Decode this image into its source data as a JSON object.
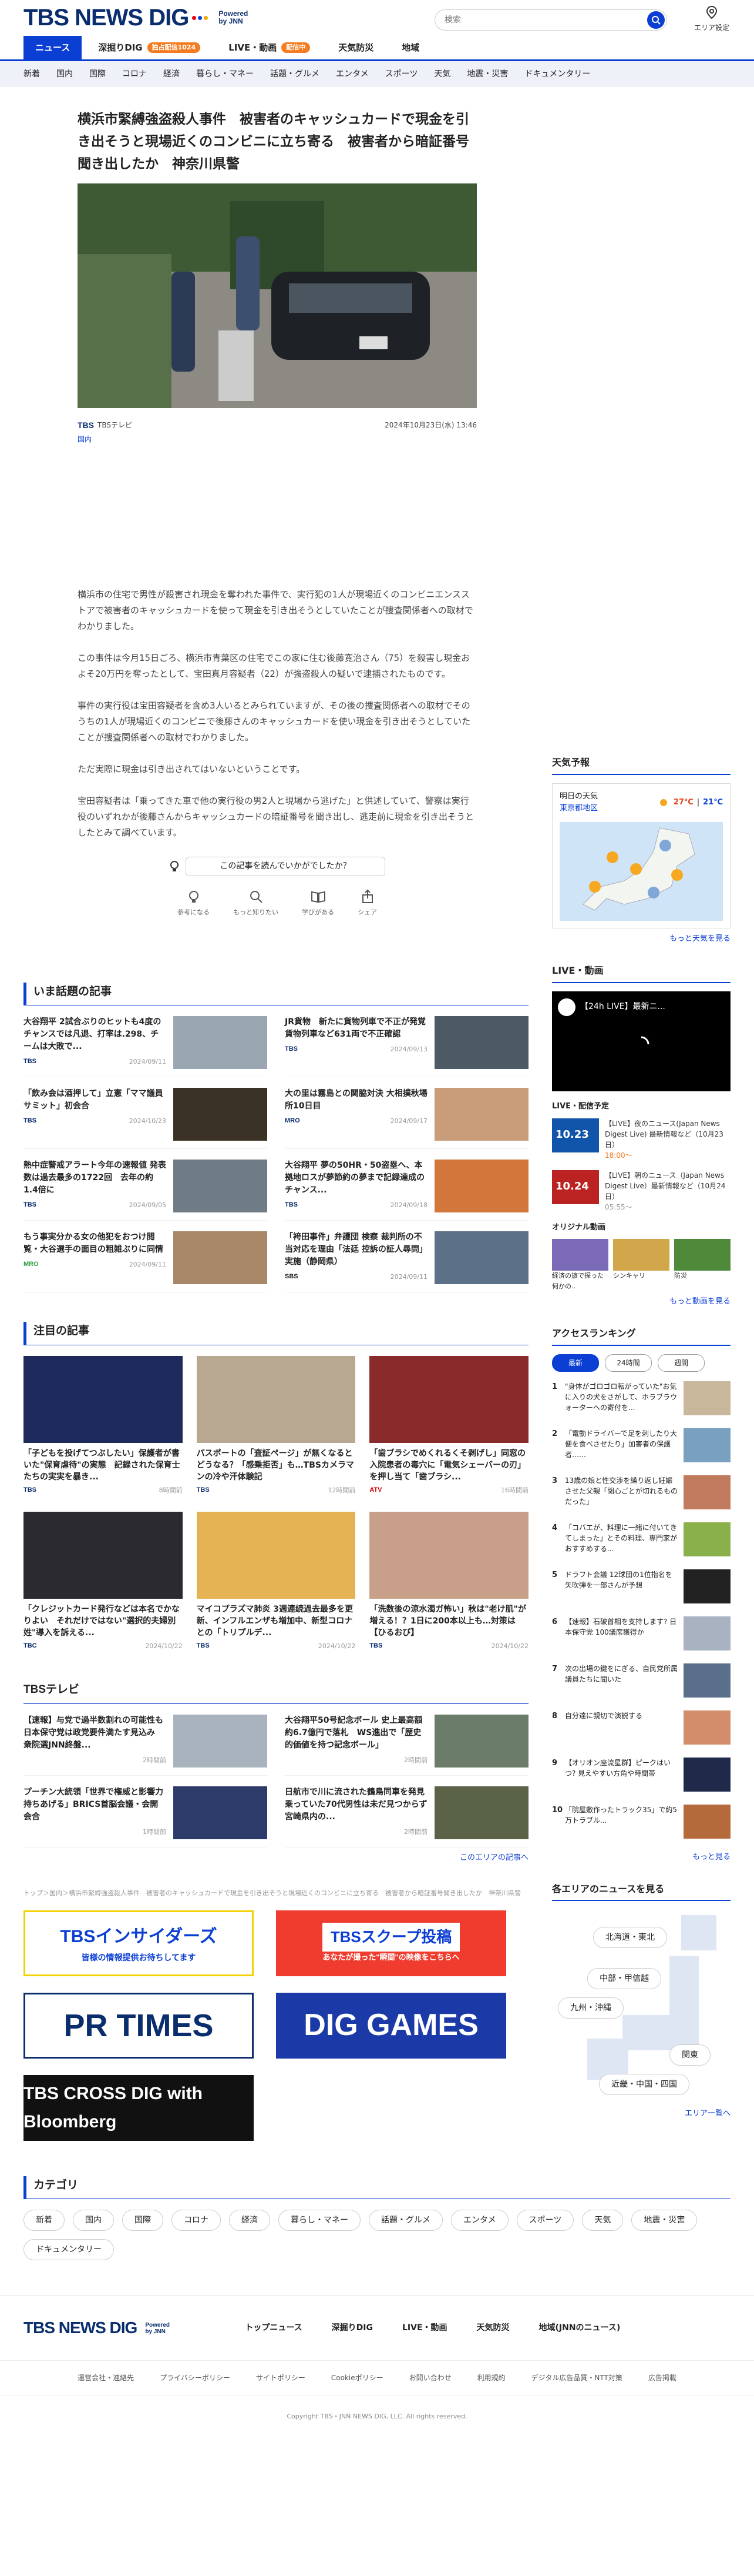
{
  "header": {
    "logo_text": "TBS NEWS DIG",
    "powered": "Powered by JNN",
    "search_placeholder": "検索",
    "area_label": "エリア設定"
  },
  "nav": {
    "tabs": [
      {
        "label": "ニュース",
        "active": true
      },
      {
        "label": "深掘りDIG",
        "badge": "独占配信1024"
      },
      {
        "label": "LIVE・動画",
        "badge": "配信中"
      },
      {
        "label": "天気防災"
      },
      {
        "label": "地域"
      }
    ],
    "categories": [
      "新着",
      "国内",
      "国際",
      "コロナ",
      "経済",
      "暮らし・マネー",
      "話題・グルメ",
      "エンタメ",
      "スポーツ",
      "天気",
      "地震・災害",
      "ドキュメンタリー"
    ]
  },
  "article": {
    "title": "横浜市緊縛強盗殺人事件　被害者のキャッシュカードで現金を引き出そうと現場近くのコンビニに立ち寄る　被害者から暗証番号聞き出したか　神奈川県警",
    "source": "TBSテレビ",
    "datetime": "2024年10月23日(水) 13:46",
    "category": "国内",
    "paragraphs": [
      "横浜市の住宅で男性が殺害され現金を奪われた事件で、実行犯の1人が現場近くのコンビニエンスストアで被害者のキャッシュカードを使って現金を引き出そうとしていたことが捜査関係者への取材でわかりました。",
      "この事件は今月15日ごろ、横浜市青葉区の住宅でこの家に住む後藤寛治さん（75）を殺害し現金およそ20万円を奪ったとして、宝田真月容疑者（22）が強盗殺人の疑いで逮捕されたものです。",
      "事件の実行役は宝田容疑者を含め3人いるとみられていますが、その後の捜査関係者への取材でそのうちの1人が現場近くのコンビニで後藤さんのキャッシュカードを使い現金を引き出そうとしていたことが捜査関係者への取材でわかりました。",
      "ただ実際に現金は引き出されてはいないということです。",
      "宝田容疑者は「乗ってきた車で他の実行役の男2人と現場から逃げた」と供述していて、警察は実行役のいずれかが後藤さんからキャッシュカードの暗証番号を聞き出し、逃走前に現金を引き出そうとしたとみて調べています。"
    ],
    "feedback_prompt": "この記事を読んでいかがでしたか？",
    "feedback_buttons": [
      "参考になる",
      "もっと知りたい",
      "学びがある",
      "シェア"
    ]
  },
  "sidebar": {
    "weather": {
      "title": "天気予報",
      "day": "明日の天気",
      "region": "東京都地区",
      "temp_high": "27℃",
      "temp_low": "21℃",
      "more": "もっと天気を見る"
    },
    "live": {
      "title": "LIVE・動画",
      "player_title": "【24h LIVE】最新ニ...",
      "schedule_title": "LIVE・配信予定",
      "items": [
        {
          "date": "10.23",
          "label": "【LIVE】夜のニュース(Japan News Digest Live) 最新情報など（10月23日）",
          "time": "18:00～"
        },
        {
          "date": "10.24",
          "label": "【LIVE】朝のニュース（Japan News Digest Live）最新情報など（10月24日）",
          "time": "05:55～"
        }
      ],
      "original_title": "オリジナル動画",
      "original_items": [
        "経済の旅で探った何かの..",
        "シンキャリ",
        "防災"
      ],
      "more": "もっと動画を見る"
    },
    "ranking": {
      "title": "アクセスランキング",
      "tabs": [
        "最新",
        "24時間",
        "週間"
      ],
      "items": [
        "\"身体がゴロゴロ転がっていた\"お気に入りの犬をさがして、ホラブラウォーターへの寄付を...",
        "「電動ドライバーで足を刺したり大便を食べさせたり」加害者の保護者……",
        "13歳の娘と性交渉を繰り返し妊娠させた父親「関心ごとが切れるものだった」",
        "「コバエが、料理に一緒に付いてきてしまった」とその料理、専門家がおすすめする...",
        "ドラフト会議 12球団の1位指名を矢吹弾を一部さんが予想",
        "【速報】石破首相を支持します? 日本保守党 100議席獲得か",
        "次の出場の鍵をにぎる、自民党所属議員たちに聞いた",
        "自分達に親切で演説する",
        "【オリオン座流星群】ピークはいつ? 見えやすい方角や時間帯",
        "「院屋敷作ったトラック35」で約5万トラブル..."
      ],
      "more": "もっと見る"
    },
    "area": {
      "title": "各エリアのニュースを見る",
      "buttons": [
        "北海道・東北",
        "中部・甲信越",
        "九州・沖縄",
        "関東",
        "近畿・中国・四国"
      ],
      "more": "エリア一覧へ"
    }
  },
  "trending": {
    "title": "いま話題の記事",
    "items": [
      {
        "text": "大谷翔平 2試合ぶりのヒットも4度のチャンスでは凡退、打率は.298、チームは大敗で...",
        "src": "TBS",
        "date": "2024/09/11"
      },
      {
        "text": "JR貨物　新たに貨物列車で不正が発覚　貨物列車など631両で不正確認",
        "src": "TBS",
        "date": "2024/09/13"
      },
      {
        "text": "「飲み会は酒押して」立憲「ママ議員サミット」初会合",
        "src": "TBS",
        "date": "2024/10/23"
      },
      {
        "text": "大の里は霧島との関脇対決 大相撲秋場所10日目",
        "src": "MRO",
        "date": "2024/09/17"
      },
      {
        "text": "熱中症警戒アラート今年の速報値 発表数は過去最多の1722回　去年の約1.4倍に",
        "src": "TBS",
        "date": "2024/09/05"
      },
      {
        "text": "大谷翔平 夢の50HR・50盗塁へ、本拠地ロスが夢節約の夢まで記録達成のチャンス...",
        "src": "TBS",
        "date": "2024/09/18"
      },
      {
        "text": "もう事実分かる女の他犯をおつけ閲覧・大谷選手の面目の粗雑ぶりに同情",
        "src": "MRO",
        "date": "2024/09/11"
      },
      {
        "text": "「袴田事件」弁護団 検察 裁判所の不当対応を理由「法廷 控訴の証人尋問」実施（静岡県）",
        "src": "SBS",
        "date": "2024/09/11"
      }
    ]
  },
  "featured": {
    "title": "注目の記事",
    "items": [
      {
        "text": "「子どもを投げてつぶしたい」保護者が書いた\"保育虐待\"の実態　記録された保育士たちの実実を暴き...",
        "src": "TBS",
        "date": "8時間前"
      },
      {
        "text": "パスポートの「査証ページ」が無くなるとどうなる？「感乗拒否」も…TBSカメラマンの冷や汗体験記",
        "src": "TBS",
        "date": "12時間前"
      },
      {
        "text": "「歯ブラシでめくれるくそ剥げし」同窓の入院患者の毒穴に「電気シェーバーの刃」を押し当て「歯ブラシ...",
        "src": "ATV",
        "date": "16時間前"
      },
      {
        "text": "「クレジットカード発行などは本名でかなりよい　それだけではない\"選択的夫婦別姓\"導入を訴える...",
        "src": "TBC",
        "date": "2024/10/22"
      },
      {
        "text": "マイコプラズマ肺炎 3週連続過去最多を更新、インフルエンザも増加中、新型コロナとの「トリプルデ...",
        "src": "TBS",
        "date": "2024/10/22"
      },
      {
        "text": "「洗数後の涼水濁ガ怖い」秋は\"老け肌\"が増える！？1日に200本以上も…対策は【ひるおび】",
        "src": "TBS",
        "date": "2024/10/22"
      }
    ]
  },
  "tbs_section": {
    "title": "TBSテレビ",
    "items": [
      {
        "text": "【速報】与党で過半数割れの可能性も　日本保守党は政党要件満たす見込み　衆院選JNN終盤...",
        "date": "2時間前"
      },
      {
        "text": "大谷翔平50号記念ボール 史上最高額 約6.7億円で落札　WS進出で「歴史的価値を持つ記念ボール」",
        "date": "2時間前"
      },
      {
        "text": "プーチン大統領「世界で権威と影響力持ちあげる」BRICS首脳会議・会開会合",
        "date": "1時間前"
      },
      {
        "text": "日航市で川に流された鶴鳥同車を発見　乗っていた70代男性は未だ見つからず　宮崎県内の...",
        "date": "2時間前"
      }
    ],
    "more": "このエリアの記事へ"
  },
  "breadcrumb": "トップ＞国内＞横浜市緊縛強盗殺人事件　被害者のキャッシュカードで現金を引き出そうと現場近くのコンビニに立ち寄る　被害者から暗証番号聞き出したか　神奈川県警",
  "banners": [
    "TBSインサイダーズ",
    "TBSスクープ投稿",
    "PR TIMES",
    "DIG GAMES",
    "TBS CROSS DIG with Bloomberg"
  ],
  "banner_sub": [
    "皆様の情報提供お待ちしてます",
    "あなたが撮った\"瞬間\"の映像をこちらへ"
  ],
  "categories_section": {
    "title": "カテゴリ",
    "items": [
      "新着",
      "国内",
      "国際",
      "コロナ",
      "経済",
      "暮らし・マネー",
      "話題・グルメ",
      "エンタメ",
      "スポーツ",
      "天気",
      "地震・災害",
      "ドキュメンタリー"
    ]
  },
  "footer": {
    "nav": [
      "トップニュース",
      "深掘りDIG",
      "LIVE・動画",
      "天気防災",
      "地域(JNNのニュース)"
    ],
    "links": [
      "運営会社・連絡先",
      "プライバシーポリシー",
      "サイトポリシー",
      "Cookieポリシー",
      "お問い合わせ",
      "利用規約",
      "デジタル広告品質・NTT対策",
      "広告掲載"
    ],
    "copyright": "Copyright TBS・JNN NEWS DIG, LLC. All rights reserved."
  }
}
